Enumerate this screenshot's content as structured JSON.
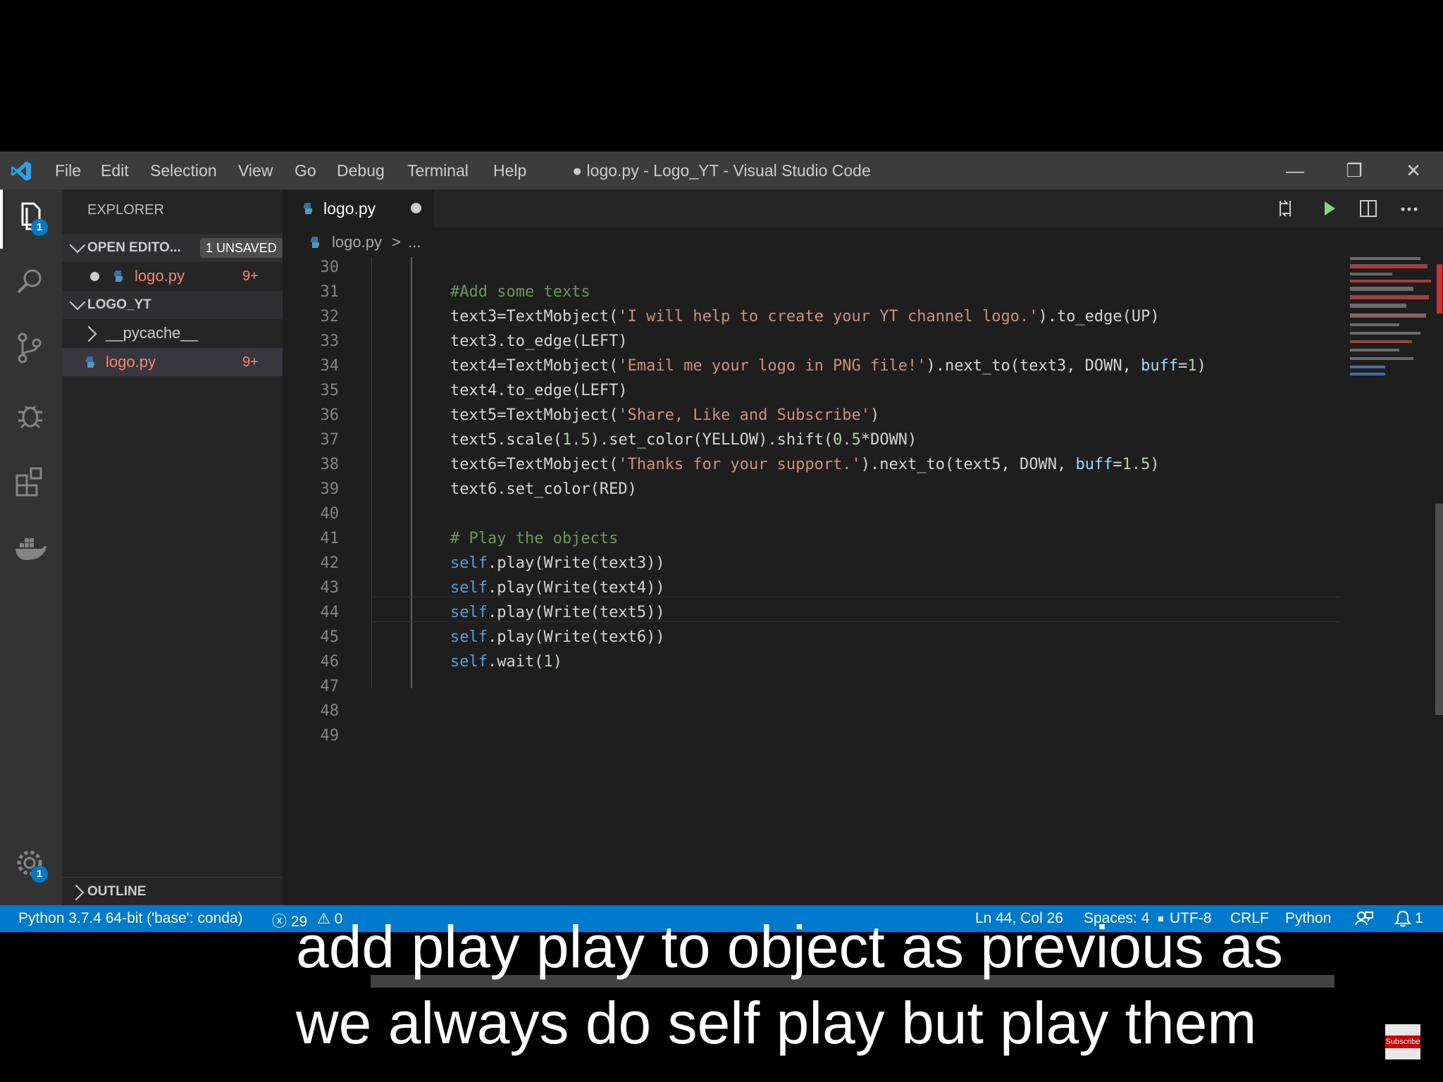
{
  "titlebar": {
    "menu": [
      "File",
      "Edit",
      "Selection",
      "View",
      "Go",
      "Debug",
      "Terminal",
      "Help"
    ],
    "title": "● logo.py - Logo_YT - Visual Studio Code",
    "minimize": "—",
    "restore": "❐",
    "close": "✕"
  },
  "activity_bar": {
    "explorer_badge": "1",
    "settings_badge": "1"
  },
  "sidebar": {
    "header": "EXPLORER",
    "open_editors": {
      "label": "OPEN EDITO...",
      "badge": "1 UNSAVED"
    },
    "open_file": {
      "name": "logo.py",
      "problems": "9+"
    },
    "project": {
      "label": "LOGO_YT"
    },
    "tree": [
      {
        "name": "__pycache__",
        "problems": ""
      },
      {
        "name": "logo.py",
        "problems": "9+"
      }
    ],
    "outline": "OUTLINE"
  },
  "tab": {
    "label": "logo.py"
  },
  "breadcrumb": {
    "file": "logo.py",
    "sep": ">",
    "more": "..."
  },
  "editor": {
    "lines": [
      {
        "n": "30",
        "t": ""
      },
      {
        "n": "31",
        "t": "#Add some texts"
      },
      {
        "n": "32",
        "t": "text3=TextMobject('I will help to create your YT channel logo.').to_edge(UP)"
      },
      {
        "n": "33",
        "t": "text3.to_edge(LEFT)"
      },
      {
        "n": "34",
        "t": "text4=TextMobject('Email me your logo in PNG file!').next_to(text3, DOWN, buff=1)"
      },
      {
        "n": "35",
        "t": "text4.to_edge(LEFT)"
      },
      {
        "n": "36",
        "t": "text5=TextMobject('Share, Like and Subscribe')"
      },
      {
        "n": "37",
        "t": "text5.scale(1.5).set_color(YELLOW).shift(0.5*DOWN)"
      },
      {
        "n": "38",
        "t": "text6=TextMobject('Thanks for your support.').next_to(text5, DOWN, buff=1.5)"
      },
      {
        "n": "39",
        "t": "text6.set_color(RED)"
      },
      {
        "n": "40",
        "t": ""
      },
      {
        "n": "41",
        "t": "# Play the objects"
      },
      {
        "n": "42",
        "t": "self.play(Write(text3))"
      },
      {
        "n": "43",
        "t": "self.play(Write(text4))"
      },
      {
        "n": "44",
        "t": "self.play(Write(text5))"
      },
      {
        "n": "45",
        "t": "self.play(Write(text6))"
      },
      {
        "n": "46",
        "t": "self.wait(1)"
      },
      {
        "n": "47",
        "t": ""
      },
      {
        "n": "48",
        "t": ""
      },
      {
        "n": "49",
        "t": ""
      }
    ]
  },
  "statusbar": {
    "interpreter": "Python 3.7.4 64-bit ('base': conda)",
    "errors": "ⓧ 29",
    "warnings": "⚠ 0",
    "position": "Ln 44, Col 26",
    "spaces": "Spaces: 4",
    "encoding": "UTF-8",
    "eol": "CRLF",
    "language": "Python",
    "notifications": "1"
  },
  "caption": {
    "line1": "add play play to object as previous as",
    "line2": "we always do self play but play them"
  },
  "subscribe": "Subscribe",
  "colors": {
    "accent": "#007acc",
    "status": "#007acc",
    "error_file": "#f48771"
  }
}
